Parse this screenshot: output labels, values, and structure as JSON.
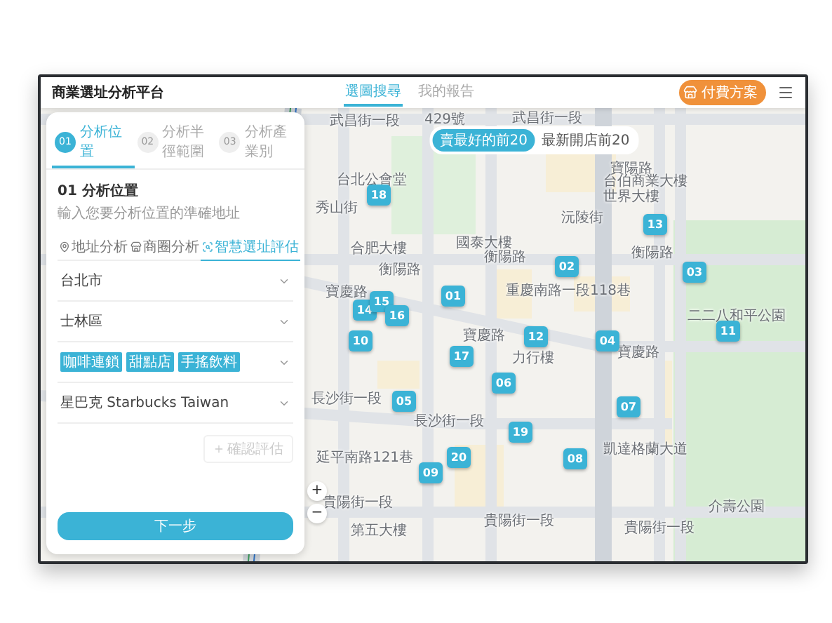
{
  "header": {
    "title": "商業選址分析平台",
    "nav": [
      {
        "label": "選圖搜尋",
        "selected": true
      },
      {
        "label": "我的報告",
        "selected": false
      }
    ],
    "plan_button": "付費方案"
  },
  "map": {
    "filters": [
      {
        "label": "賣最好的前20",
        "selected": true
      },
      {
        "label": "最新開店前20",
        "selected": false
      }
    ],
    "labels": [
      "武昌街一段",
      "429號",
      "武昌街一段",
      "台北公會堂",
      "秀山街",
      "合肥大樓",
      "國泰大樓",
      "沅陵街",
      "寶陽路",
      "台伯商業大樓",
      "世界大樓",
      "衡陽路",
      "衡陽路",
      "衡陽路",
      "寶慶路",
      "重慶南路一段118巷",
      "寶慶路",
      "寶慶路",
      "力行樓",
      "二二八和平公園",
      "長沙街一段",
      "長沙街一段",
      "凱達格蘭大道",
      "延平南路121巷",
      "貴陽街一段",
      "貴陽街一段",
      "貴陽街一段",
      "第五大樓",
      "介壽公園"
    ],
    "markers": [
      "01",
      "02",
      "03",
      "04",
      "05",
      "06",
      "07",
      "08",
      "09",
      "10",
      "11",
      "12",
      "13",
      "14",
      "15",
      "16",
      "17",
      "18",
      "19",
      "20"
    ]
  },
  "panel": {
    "steps": [
      {
        "number": "01",
        "label": "分析位置",
        "selected": true
      },
      {
        "number": "02",
        "label": "分析半徑範圍",
        "selected": false
      },
      {
        "number": "03",
        "label": "分析產業別",
        "selected": false
      }
    ],
    "heading": "01 分析位置",
    "hint": "輸入您要分析位置的準確地址",
    "modes": [
      {
        "label": "地址分析",
        "selected": false
      },
      {
        "label": "商圈分析",
        "selected": false
      },
      {
        "label": "智慧選址評估",
        "selected": true
      }
    ],
    "fields": [
      {
        "kind": "select",
        "value": "台北市"
      },
      {
        "kind": "select",
        "value": "士林區"
      },
      {
        "kind": "tags",
        "tags": [
          "咖啡連鎖",
          "甜點店",
          "手搖飲料"
        ]
      },
      {
        "kind": "select",
        "value": "星巴克 Starbucks Taiwan"
      }
    ],
    "confirm": {
      "label": "確認評估",
      "disabled": true
    },
    "next": "下一步"
  },
  "zoom": [
    "+",
    "−"
  ]
}
